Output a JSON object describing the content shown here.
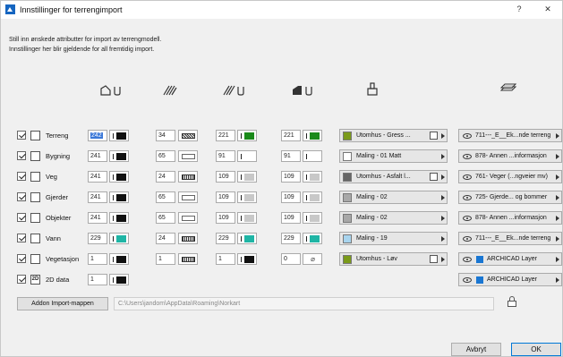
{
  "window": {
    "title": "Innstillinger for terrengimport",
    "help": "?",
    "close": "✕"
  },
  "intro": {
    "line1": "Still inn ønskede attributter for import av terrengmodell.",
    "line2": "Innstillinger her blir gjeldende for all fremtidig import."
  },
  "columns": [
    "line-pen",
    "fill-pattern",
    "fill-pen",
    "background-pen",
    "surface-material",
    "layer"
  ],
  "rows": [
    {
      "id": "terreng",
      "label": "Terreng",
      "icon": "terrain-icon",
      "pen1": "242",
      "pen1_color": "#111111",
      "pen1_selected": true,
      "pat": "34",
      "pat_type": "dots",
      "pen2": "221",
      "pen2_color": "#1a8a1a",
      "pen3": "221",
      "pen3_color": "#1a8a1a",
      "mat_color": "#7a9a1a",
      "mat": "Utomhus - Gress ...",
      "mat_icon": true,
      "layer": "711---_E__Ek...nde terreng",
      "layer_ac": false
    },
    {
      "id": "bygning",
      "label": "Bygning",
      "icon": "building-icon",
      "pen1": "241",
      "pen1_color": "#111111",
      "pat": "65",
      "pat_type": "empty",
      "pen2": "91",
      "pen2_color": "#ffffff",
      "pen3": "91",
      "pen3_color": "#ffffff",
      "mat_color": "#ffffff",
      "mat": "Maling - 01 Matt",
      "mat_icon": false,
      "layer": "878- Annen ...informasjon",
      "layer_ac": false
    },
    {
      "id": "veg",
      "label": "Veg",
      "icon": "road-icon",
      "pen1": "241",
      "pen1_color": "#111111",
      "pat": "24",
      "pat_type": "hatch",
      "pen2": "109",
      "pen2_color": "#c8c8c8",
      "pen3": "109",
      "pen3_color": "#c8c8c8",
      "mat_color": "#666666",
      "mat": "Utomhus - Asfalt l...",
      "mat_icon": true,
      "layer": "761- Veger (...ngveier mv)",
      "layer_ac": false
    },
    {
      "id": "gjerder",
      "label": "Gjerder",
      "icon": "fence-icon",
      "pen1": "241",
      "pen1_color": "#111111",
      "pat": "65",
      "pat_type": "empty",
      "pen2": "109",
      "pen2_color": "#c8c8c8",
      "pen3": "109",
      "pen3_color": "#c8c8c8",
      "mat_color": "#a8a8a8",
      "mat": "Maling - 02",
      "mat_icon": false,
      "layer": "725- Gjerde... og bommer",
      "layer_ac": false
    },
    {
      "id": "objekter",
      "label": "Objekter",
      "icon": "objects-icon",
      "pen1": "241",
      "pen1_color": "#111111",
      "pat": "65",
      "pat_type": "empty",
      "pen2": "109",
      "pen2_color": "#c8c8c8",
      "pen3": "109",
      "pen3_color": "#c8c8c8",
      "mat_color": "#a8a8a8",
      "mat": "Maling - 02",
      "mat_icon": false,
      "layer": "878- Annen ...informasjon",
      "layer_ac": false
    },
    {
      "id": "vann",
      "label": "Vann",
      "icon": "water-icon",
      "pen1": "229",
      "pen1_color": "#1fb5a5",
      "pat": "24",
      "pat_type": "hatch",
      "pen2": "229",
      "pen2_color": "#1fb5a5",
      "pen3": "229",
      "pen3_color": "#1fb5a5",
      "mat_color": "#a8d4ee",
      "mat": "Maling - 19",
      "mat_icon": false,
      "layer": "711---_E__Ek...nde terreng",
      "layer_ac": false
    },
    {
      "id": "vegetasjon",
      "label": "Vegetasjon",
      "icon": "vegetation-icon",
      "pen1": "1",
      "pen1_color": "#111111",
      "pat": "1",
      "pat_type": "hatch",
      "pen2": "1",
      "pen2_color": "#111111",
      "pen3": "0",
      "pen3_null": "⌀",
      "mat_color": "#7a9a1a",
      "mat": "Utomhus - Løv",
      "mat_icon": true,
      "layer": "ARCHICAD Layer",
      "layer_ac": true
    },
    {
      "id": "2d-data",
      "label": "2D data",
      "icon": "2d-icon",
      "icon_text": "2D",
      "pen1": "1",
      "pen1_color": "#111111",
      "layer": "ARCHICAD Layer",
      "layer_ac": true,
      "only_pen1": true
    }
  ],
  "addon": {
    "button": "Addon Import-mappen",
    "path": "C:\\Users\\jandom\\AppData\\Roaming\\Norkart"
  },
  "buttons": {
    "cancel": "Avbryt",
    "ok": "OK"
  }
}
